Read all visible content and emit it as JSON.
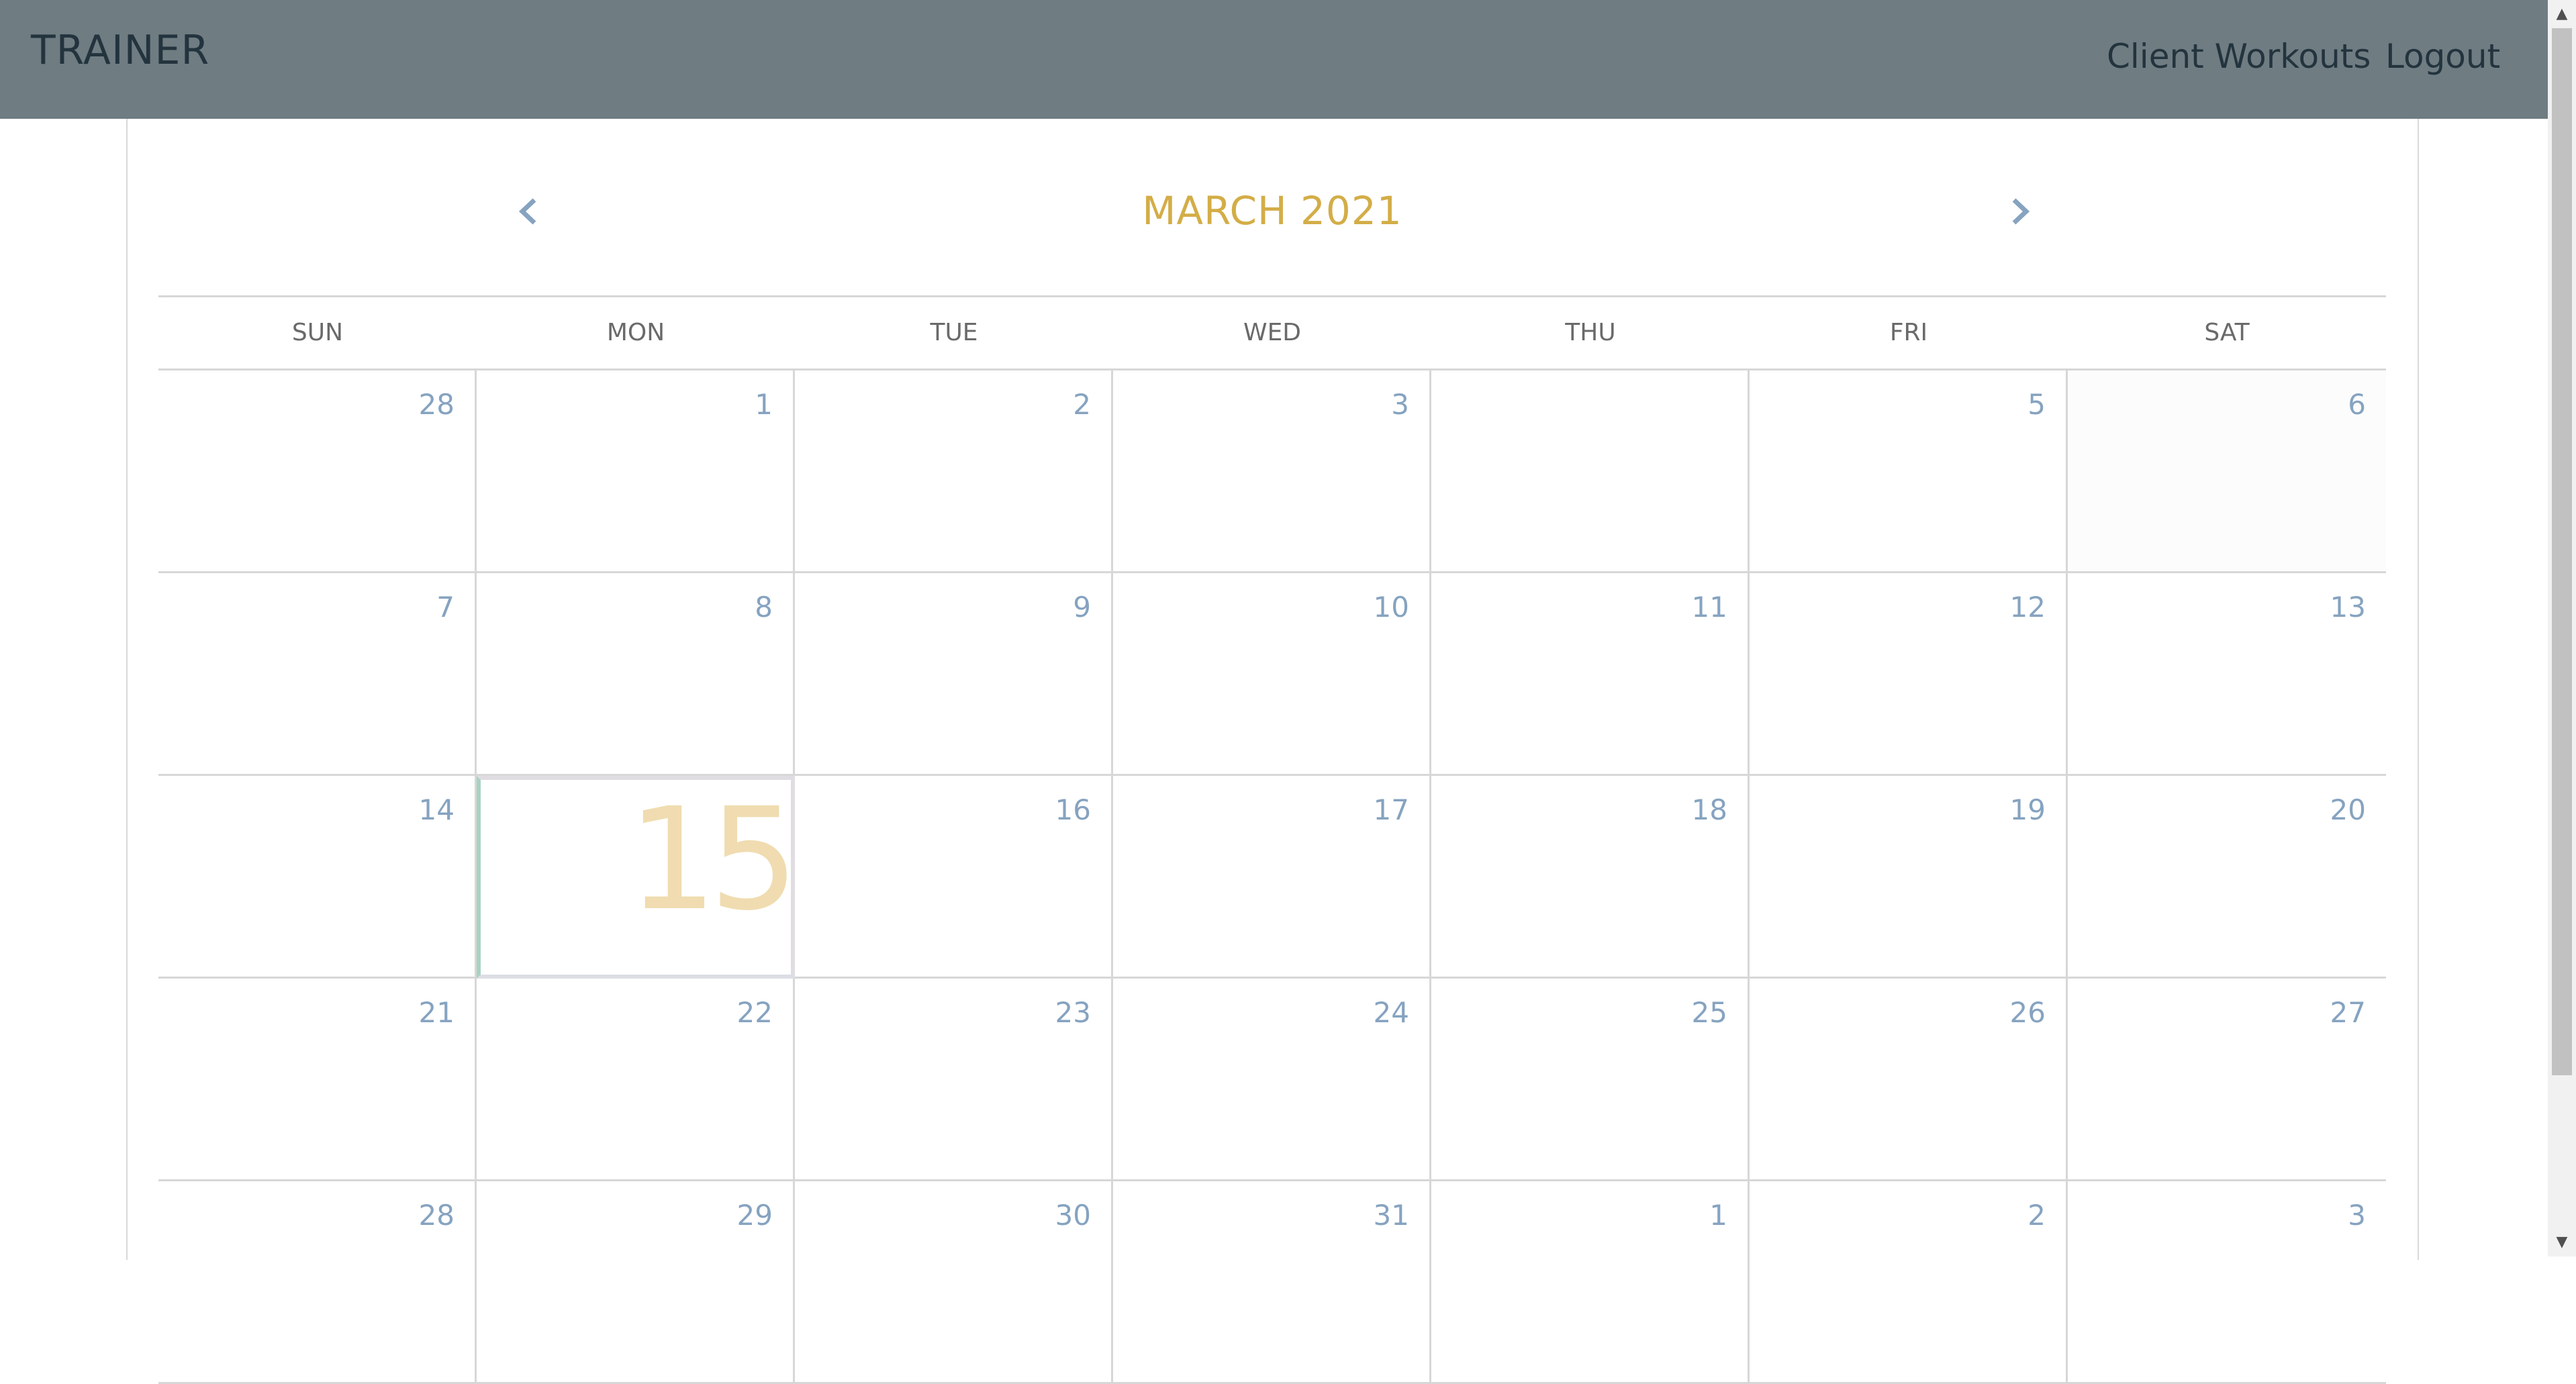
{
  "navbar": {
    "brand": "TRAINER",
    "links": [
      "Client Workouts",
      "Logout"
    ]
  },
  "calendar": {
    "title": "MARCH 2021",
    "weekdays": [
      "SUN",
      "MON",
      "TUE",
      "WED",
      "THU",
      "FRI",
      "SAT"
    ],
    "today": "15",
    "weeks": [
      [
        "28",
        "1",
        "2",
        "3",
        "",
        "5",
        "6"
      ],
      [
        "7",
        "8",
        "9",
        "10",
        "11",
        "12",
        "13"
      ],
      [
        "14",
        "15",
        "16",
        "17",
        "18",
        "19",
        "20"
      ],
      [
        "21",
        "22",
        "23",
        "24",
        "25",
        "26",
        "27"
      ],
      [
        "28",
        "29",
        "30",
        "31",
        "1",
        "2",
        "3"
      ]
    ]
  },
  "colors": {
    "navbar_bg": "#6f7c82",
    "brand_text": "#23343e",
    "month_title": "#d3ad47",
    "day_number": "#86a3c0",
    "today_number": "#f0dcb0",
    "arrow": "#86a3c0"
  },
  "icons": {
    "prev": "chevron-left-icon",
    "next": "chevron-right-icon"
  }
}
